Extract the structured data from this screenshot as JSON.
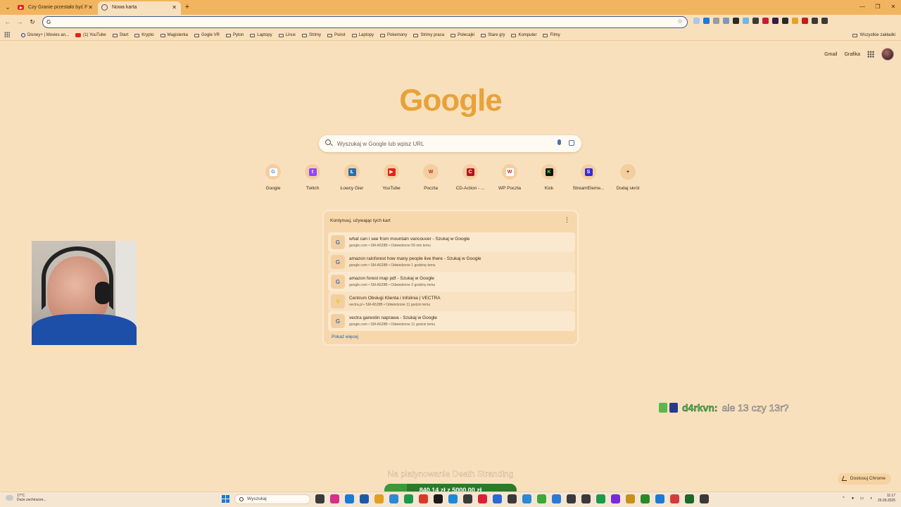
{
  "tabs": [
    {
      "title": "Czy Granie przestało być FAJNE",
      "active": false,
      "favicon": "youtube-icon"
    },
    {
      "title": "Nowa karta",
      "active": true,
      "favicon": "globe-icon"
    }
  ],
  "omnibox": {
    "value": "",
    "placeholder": ""
  },
  "bookmarks": [
    {
      "label": "Disney+ | Movies an...",
      "icon": "disney-icon"
    },
    {
      "label": "(1) YouTube",
      "icon": "youtube-icon"
    },
    {
      "label": "Start",
      "icon": "folder-icon"
    },
    {
      "label": "Krypto",
      "icon": "folder-icon"
    },
    {
      "label": "Magisterka",
      "icon": "folder-icon"
    },
    {
      "label": "Gogle VR",
      "icon": "folder-icon"
    },
    {
      "label": "Pyton",
      "icon": "folder-icon"
    },
    {
      "label": "Laptopy",
      "icon": "folder-icon"
    },
    {
      "label": "Linux",
      "icon": "folder-icon"
    },
    {
      "label": "Strimy",
      "icon": "folder-icon"
    },
    {
      "label": "Poirot",
      "icon": "folder-icon"
    },
    {
      "label": "Laptopy",
      "icon": "folder-icon"
    },
    {
      "label": "Pokemony",
      "icon": "folder-icon"
    },
    {
      "label": "Strimy praca",
      "icon": "folder-icon"
    },
    {
      "label": "Polecajki",
      "icon": "folder-icon"
    },
    {
      "label": "Stare gry",
      "icon": "folder-icon"
    },
    {
      "label": "Komputer",
      "icon": "folder-icon"
    },
    {
      "label": "Filmy",
      "icon": "folder-icon"
    }
  ],
  "bookmarks_all": "Wszystkie zakładki",
  "top_links": {
    "gmail": "Gmail",
    "images": "Grafika"
  },
  "logo": "Google",
  "search": {
    "placeholder": "Wyszukaj w Google lub wpisz URL"
  },
  "shortcuts": [
    {
      "label": "Google",
      "color": "#ffffff",
      "glyph": "G",
      "glyph_color": "#4285f4"
    },
    {
      "label": "Twitch",
      "color": "#9146ff",
      "glyph": "t",
      "glyph_color": "#ffffff"
    },
    {
      "label": "Łowcy Gier",
      "color": "#2b6ea8",
      "glyph": "Ł",
      "glyph_color": "#ffffff"
    },
    {
      "label": "YouTube",
      "color": "#e62117",
      "glyph": "▶",
      "glyph_color": "#ffffff"
    },
    {
      "label": "Poczta",
      "color": "#f3cfa0",
      "glyph": "W",
      "glyph_color": "#d21c1c"
    },
    {
      "label": "CD-Action - ...",
      "color": "#b4141a",
      "glyph": "C",
      "glyph_color": "#ffffff"
    },
    {
      "label": "WP Poczta",
      "color": "#ffffff",
      "glyph": "W",
      "glyph_color": "#d21c1c"
    },
    {
      "label": "Kick",
      "color": "#111111",
      "glyph": "K",
      "glyph_color": "#53fc18"
    },
    {
      "label": "StreamEleme...",
      "color": "#3a2bd1",
      "glyph": "S",
      "glyph_color": "#ffffff"
    },
    {
      "label": "Dodaj skrót",
      "color": "#f3cfa0",
      "glyph": "+",
      "glyph_color": "#3a2a10"
    }
  ],
  "continue_card": {
    "title": "Kontynuuj, używając tych kart",
    "rows": [
      {
        "title": "what can i see from mountain vancouver - Szukaj w Google",
        "subtitle": "google.com • SM-A528B • Odwiedzone 59 min temu",
        "icon": "G"
      },
      {
        "title": "amazon rainforest how many people live there - Szukaj w Google",
        "subtitle": "google.com • SM-A528B • Odwiedzone 1 godzinę temu",
        "icon": "G"
      },
      {
        "title": "amazon forest map pdf - Szukaj w Google",
        "subtitle": "google.com • SM-A528B • Odwiedzone 2 godziny temu",
        "icon": "G"
      },
      {
        "title": "Centrum Obsługi Klienta i Infolinia | VECTRA",
        "subtitle": "vectra.pl • SM-A528B • Odwiedzone 11 godzin temu",
        "icon": "V"
      },
      {
        "title": "vectra garwolin naprawa - Szukaj w Google",
        "subtitle": "google.com • SM-A528B • Odwiedzone 11 godzin temu",
        "icon": "G"
      }
    ],
    "show_more": "Pokaż więcej"
  },
  "chat": {
    "user": "d4rkvn:",
    "message": "ale 13 czy 13r?"
  },
  "donation": {
    "label": "Na platynowanie Death Stranding",
    "current": "840,14 zł",
    "separator": "z",
    "goal": "5000,00 zł",
    "progress": 0.168
  },
  "customize": "Dostosuj Chrome",
  "taskbar": {
    "weather_temp": "17°C",
    "weather_desc": "Duże zachmurze...",
    "search": "Wyszukaj",
    "time": "11:17",
    "date": "25.09.2025",
    "apps": [
      "#3a3a3a",
      "#d6308a",
      "#1a7ad8",
      "#1a5aa8",
      "#e0a020",
      "#2a8ad8",
      "#1a9a4a",
      "#d83a2a",
      "#1a1a1a",
      "#1a8ad8",
      "#3a3a3a",
      "#d8203a",
      "#2a6ad8",
      "#3a3a3a",
      "#2a8ad8",
      "#3aa83a",
      "#2a7ad8",
      "#3a3a3a",
      "#3a3a3a",
      "#1a9a4a",
      "#7a2ad8",
      "#c8901a",
      "#2a8a2a",
      "#1a7ad8",
      "#d83a3a",
      "#1a6a2a",
      "#3a3a3a"
    ]
  },
  "extensions": [
    "#a8c8e8",
    "#1a7ad8",
    "#9a9a9a",
    "#7a9ab8",
    "#2a2a2a",
    "#6ab8e8",
    "#3a3a3a",
    "#c81a3a",
    "#3a1a4a",
    "#2a2a2a",
    "#e8a020",
    "#c81a1a",
    "#3a3a3a",
    "#3a3a3a"
  ],
  "webcam_label": ""
}
